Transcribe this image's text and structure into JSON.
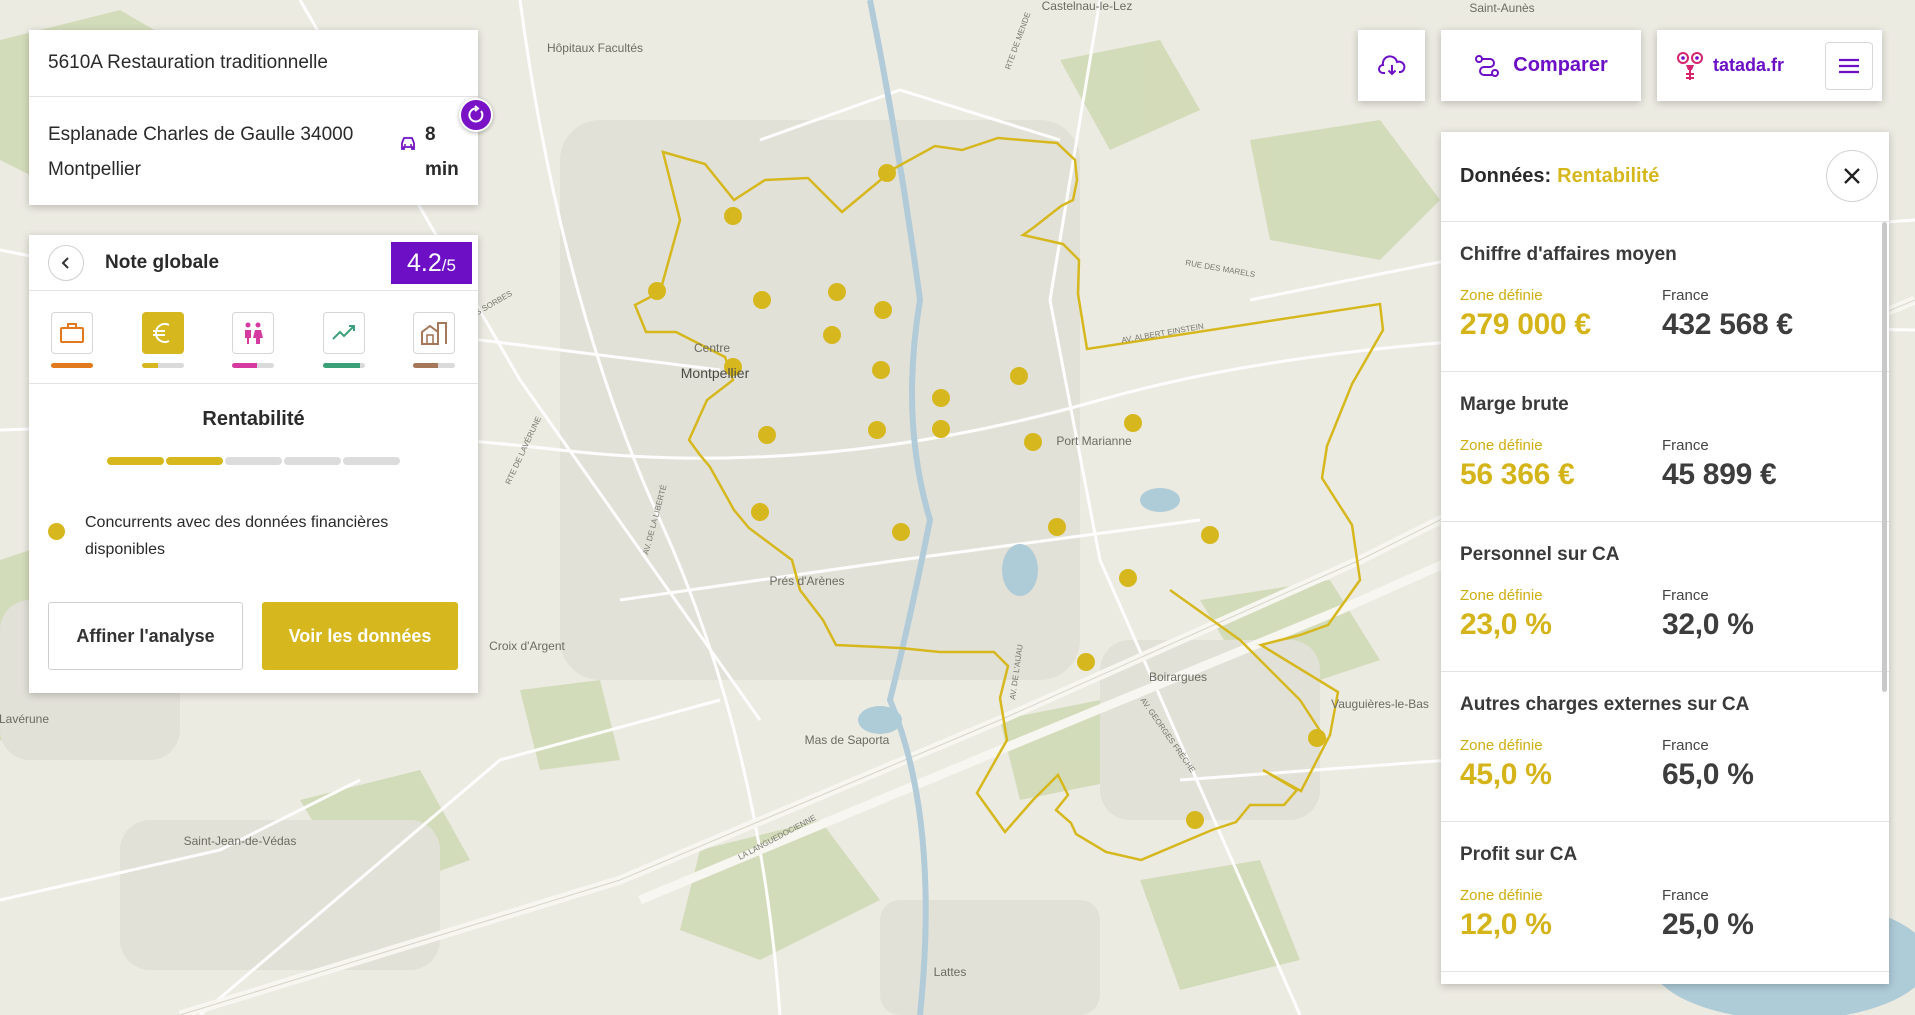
{
  "activity": {
    "title": "5610A Restauration traditionnelle",
    "address": "Esplanade Charles de Gaulle 34000 Montpellier",
    "travel_time": "8 min",
    "travel_icon": "car-icon"
  },
  "score": {
    "title": "Note globale",
    "value": "4.2",
    "denominator": "/5",
    "categories": [
      {
        "name": "business",
        "icon": "briefcase-icon",
        "color": "#e07a1c",
        "level": 1.0,
        "active": false
      },
      {
        "name": "rentabilite",
        "icon": "euro-icon",
        "color": "#d6b81e",
        "level": 0.4,
        "active": true
      },
      {
        "name": "population",
        "icon": "people-icon",
        "color": "#d43aa0",
        "level": 0.6,
        "active": false
      },
      {
        "name": "dynamisme",
        "icon": "trend-icon",
        "color": "#3aa07a",
        "level": 0.9,
        "active": false
      },
      {
        "name": "immobilier",
        "icon": "buildings-icon",
        "color": "#a5785a",
        "level": 0.6,
        "active": false
      }
    ],
    "section_title": "Rentabilité",
    "progress": {
      "filled": 2,
      "total": 5
    },
    "legend_text": "Concurrents avec des données financières disponibles",
    "btn_refine": "Affiner l'analyse",
    "btn_data": "Voir les données"
  },
  "toolbar": {
    "compare_label": "Comparer",
    "brand_label": "tatada.fr"
  },
  "data_panel": {
    "header_label": "Données:",
    "header_value": "Rentabilité",
    "zone_label": "Zone définie",
    "france_label": "France",
    "metrics": [
      {
        "title": "Chiffre d'affaires moyen",
        "zone": "279 000 €",
        "france": "432 568 €"
      },
      {
        "title": "Marge brute",
        "zone": "56 366 €",
        "france": "45 899 €"
      },
      {
        "title": "Personnel sur CA",
        "zone": "23,0 %",
        "france": "32,0 %"
      },
      {
        "title": "Autres charges externes sur CA",
        "zone": "45,0 %",
        "france": "65,0 %"
      },
      {
        "title": "Profit sur CA",
        "zone": "12,0 %",
        "france": "25,0 %"
      }
    ]
  },
  "map": {
    "labels": {
      "centre": "Centre",
      "montpellier": "Montpellier",
      "port_marianne": "Port Marianne",
      "pres_arenes": "Prés d'Arènes",
      "croix_argent": "Croix d'Argent",
      "mas_saporta": "Mas de Saporta",
      "boirargues": "Boirargues",
      "vauguieres": "Vauguières-le-Bas",
      "saint_jean": "Saint-Jean-de-Védas",
      "lattes": "Lattes",
      "laverune": "Lavérune",
      "hopitaux": "Hôpitaux Facultés",
      "castelnau": "Castelnau-le-Lez",
      "saint_aunes": "Saint-Aunès",
      "rte_laverune": "RTE DE LAVÉRUNE",
      "av_liberte": "AV. DE LA LIBERTÉ",
      "la_languedocienne": "LA LANGUEDOCIENNE",
      "av_albert_einstein": "AV. ALBERT EINSTEIN",
      "av_georges_freche": "AV. GEORGES FRÈCHE",
      "av_de_lattes": "AV. DE L'AIJAU",
      "rue_marels": "RUE DES MARELS",
      "route_de_mende": "RTE DE MENDE",
      "rte_sorbes": "RTE DES SORBES"
    },
    "competitors": [
      [
        887,
        173
      ],
      [
        733,
        216
      ],
      [
        657,
        291
      ],
      [
        762,
        300
      ],
      [
        837,
        292
      ],
      [
        832,
        335
      ],
      [
        883,
        310
      ],
      [
        733,
        367
      ],
      [
        767,
        435
      ],
      [
        881,
        370
      ],
      [
        941,
        398
      ],
      [
        877,
        430
      ],
      [
        941,
        429
      ],
      [
        1019,
        376
      ],
      [
        1033,
        442
      ],
      [
        1133,
        423
      ],
      [
        760,
        512
      ],
      [
        901,
        532
      ],
      [
        1057,
        527
      ],
      [
        1210,
        535
      ],
      [
        1128,
        578
      ],
      [
        1086,
        662
      ],
      [
        1317,
        738
      ],
      [
        1195,
        820
      ]
    ],
    "zone_color": "#d6b81e"
  }
}
